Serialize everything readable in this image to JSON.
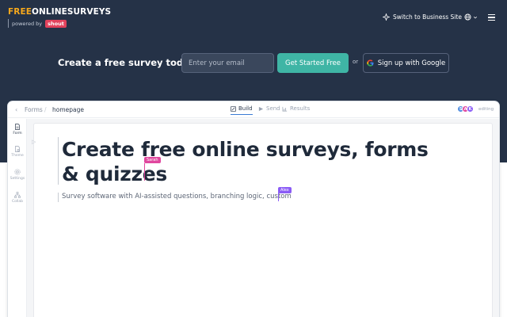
{
  "header": {
    "logo_free": "FREE",
    "logo_rest": "ONLINESURVEYS",
    "powered_by": "powered by",
    "shout": "shout",
    "switch_label": "Switch to Business Site"
  },
  "cta": {
    "title": "Create a free survey today",
    "email_placeholder": "Enter your email",
    "get_started": "Get Started Free",
    "or": "or",
    "google": "Sign up with Google"
  },
  "editor": {
    "back": "‹",
    "breadcrumb_forms": "Forms",
    "breadcrumb_sep": "/",
    "breadcrumb_page": "homepage",
    "tabs": [
      {
        "label": "Build",
        "active": true
      },
      {
        "label": "Send",
        "active": false
      },
      {
        "label": "Results",
        "active": false
      }
    ],
    "avatars": [
      "S",
      "A",
      "K"
    ],
    "editing": "editing",
    "sidebar": [
      {
        "label": "Form",
        "icon": "form-icon"
      },
      {
        "label": "Theme",
        "icon": "theme-icon"
      },
      {
        "label": "Settings",
        "icon": "settings-icon"
      },
      {
        "label": "Collab",
        "icon": "collab-icon"
      }
    ],
    "headline": "Create free online surveys, forms & quizzes",
    "subline": "Survey software with AI-assisted questions, branching logic, custom",
    "cursor_sarah": "Sarah",
    "cursor_alex": "Alex"
  },
  "colors": {
    "hero_bg": "#253247",
    "accent_teal": "#3fb5a5",
    "brand_orange": "#f6a81c",
    "shout_red": "#e2425c",
    "sarah_pink": "#e0479e",
    "alex_purple": "#8b5cf6"
  }
}
